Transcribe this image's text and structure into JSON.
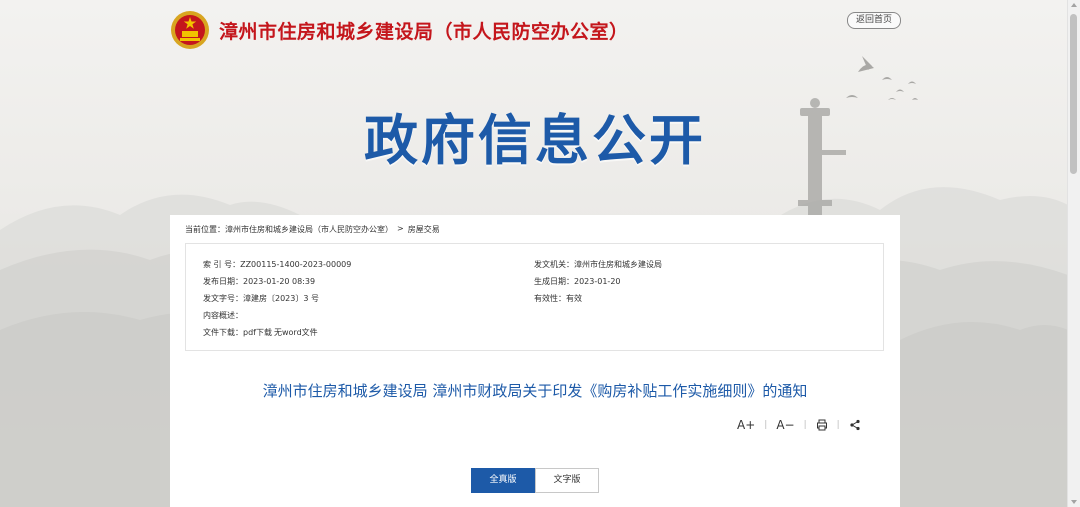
{
  "header": {
    "site_title": "漳州市住房和城乡建设局（市人民防空办公室）",
    "home_button": "返回首页"
  },
  "banner": {
    "title": "政府信息公开"
  },
  "breadcrumb": {
    "prefix": "当前位置：",
    "items": [
      "漳州市住房和城乡建设局（市人民防空办公室）",
      "房屋交易"
    ],
    "separator": ">"
  },
  "meta": {
    "index_label": "索 引 号：",
    "index_value": "ZZ00115-1400-2023-00009",
    "issuer_label": "发文机关：",
    "issuer_value": "漳州市住房和城乡建设局",
    "publish_label": "发布日期：",
    "publish_value": "2023-01-20 08:39",
    "created_label": "生成日期：",
    "created_value": "2023-01-20",
    "docno_label": "发文字号：",
    "docno_value": "漳建房〔2023〕3 号",
    "validity_label": "有效性：",
    "validity_value": "有效",
    "summary_label": "内容概述：",
    "download_label": "文件下载：",
    "download_pdf": "pdf下载",
    "download_word": "无word文件"
  },
  "article": {
    "title": "漳州市住房和城乡建设局 漳州市财政局关于印发《购房补贴工作实施细则》的通知"
  },
  "tools": {
    "font_larger": "A+",
    "font_smaller": "A−"
  },
  "version_tabs": {
    "full": "全真版",
    "text": "文字版"
  },
  "colors": {
    "brand_red": "#c4161c",
    "brand_blue": "#1d5aa8"
  }
}
